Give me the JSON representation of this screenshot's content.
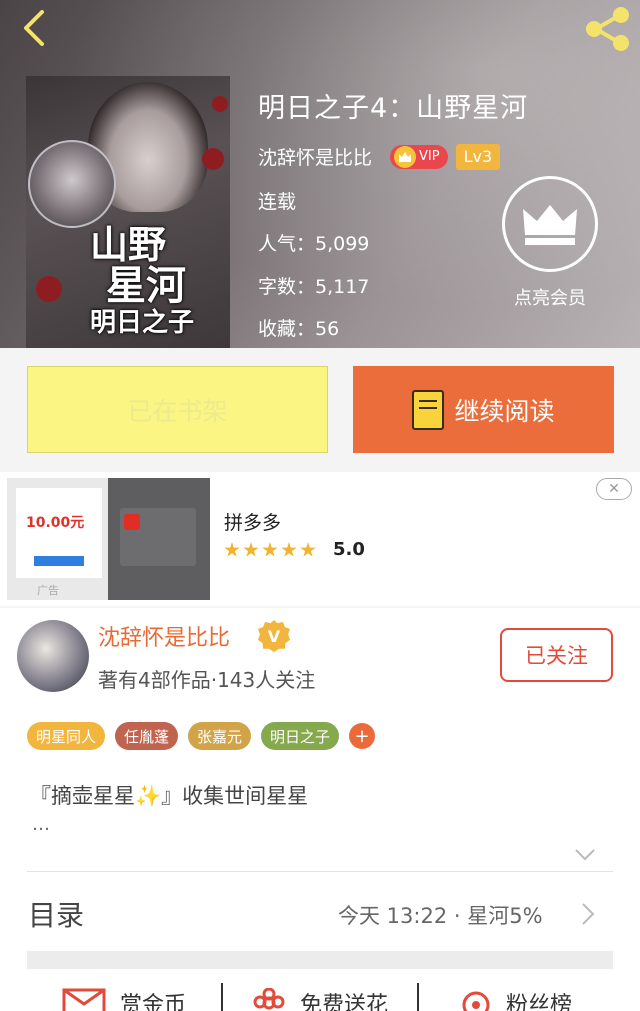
{
  "book": {
    "title": "明日之子4：山野星河",
    "author": "沈辞怀是比比",
    "vip_label": "VIP",
    "level": "Lv3",
    "status": "连载",
    "popularity": "人气：5,099",
    "word_count": "字数：5,117",
    "favorites": "收藏：56",
    "cover_title_1": "山野",
    "cover_title_2": "星河",
    "cover_title_3": "明日之子"
  },
  "member": {
    "label": "点亮会员"
  },
  "actions": {
    "shelf_label": "已在书架",
    "read_label": "继续阅读"
  },
  "ad": {
    "app_name": "拼多多",
    "rating": "5.0",
    "label": "广告",
    "close_symbol": "✕",
    "card_text": "10.00元"
  },
  "author_card": {
    "name": "沈辞怀是比比",
    "verified_symbol": "V",
    "stats": "著有4部作品·143人关注",
    "follow_label": "已关注",
    "tags": [
      {
        "label": "明星同人",
        "color": "#f2b53d"
      },
      {
        "label": "任胤蓬",
        "color": "#c0634f"
      },
      {
        "label": "张嘉元",
        "color": "#d2a449"
      },
      {
        "label": "明日之子",
        "color": "#86a94e"
      }
    ],
    "tag_add": "+",
    "description": "『摘壶星星✨』收集世间星星",
    "description_more": "…"
  },
  "toc": {
    "title": "目录",
    "meta": "今天 13:22 · 星河5%"
  },
  "bottom": {
    "coin": "赏金币",
    "flower": "免费送花",
    "fans": "粉丝榜"
  },
  "colors": {
    "accent": "#ea6d3b",
    "shelf": "#fbf584",
    "follow": "#e24b3a"
  }
}
